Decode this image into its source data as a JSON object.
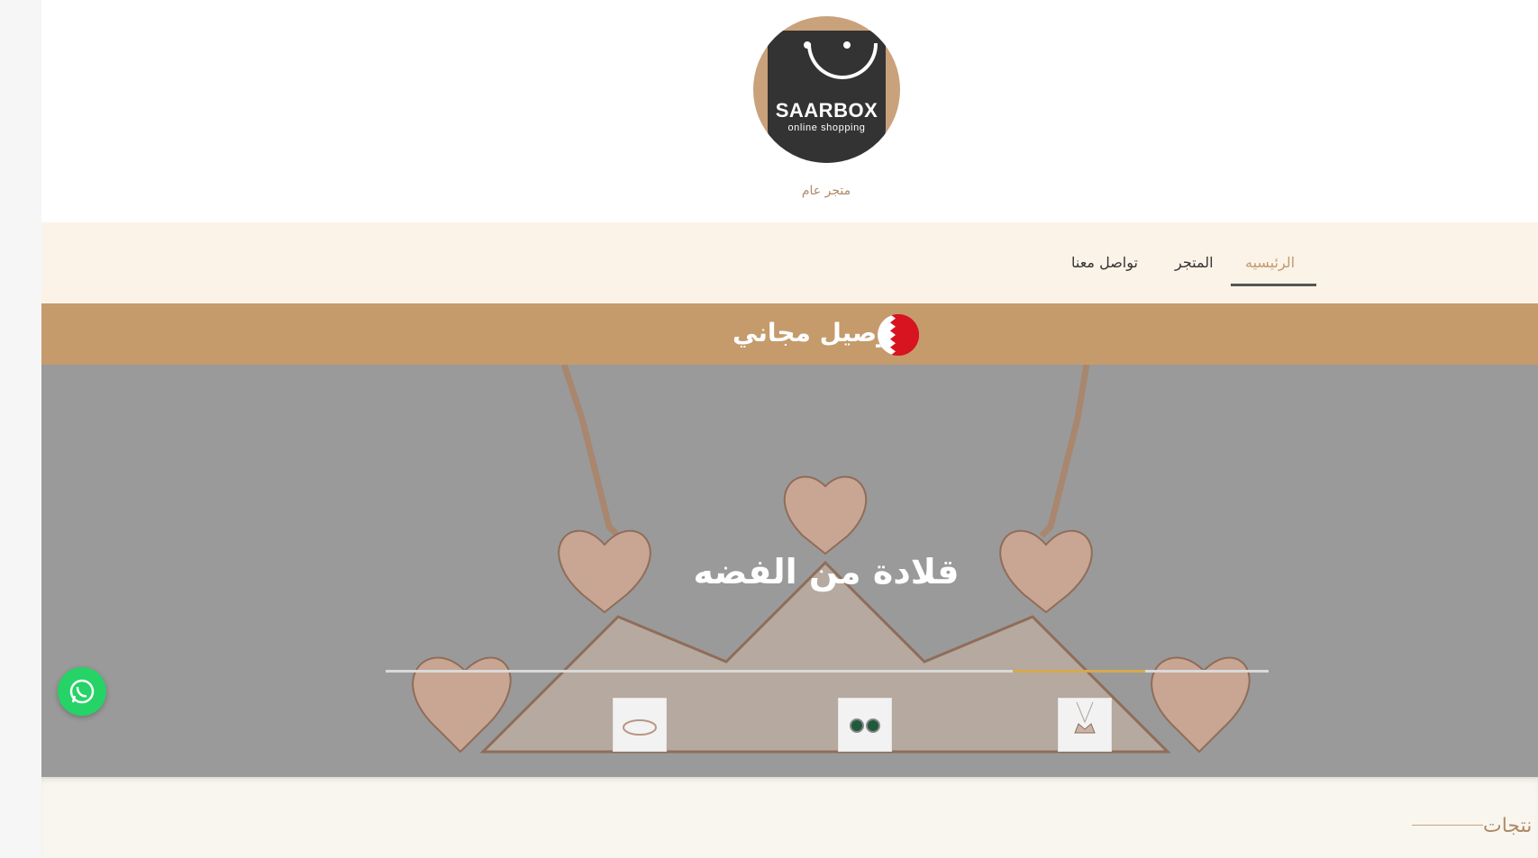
{
  "brand": {
    "logo_title": "SAARBOX",
    "logo_subtitle": "online shopping",
    "tagline": "متجر عام"
  },
  "nav": {
    "items": [
      {
        "label": "الرئيسيه",
        "active": true
      },
      {
        "label": "المتجر",
        "active": false
      },
      {
        "label": "تواصل معنا",
        "active": false
      }
    ]
  },
  "promo": {
    "text": "توصيل مجاني",
    "flag_icon": "bahrain-flag-icon"
  },
  "hero": {
    "title": "قلادة من الفضه",
    "slider_progress_percent": 15,
    "thumbnails": [
      {
        "name": "ring-thumbnail"
      },
      {
        "name": "earrings-thumbnail"
      },
      {
        "name": "crown-necklace-thumbnail",
        "active": true
      }
    ]
  },
  "section": {
    "title": "نتجات"
  },
  "colors": {
    "accent": "#c59b6c",
    "nav_bg": "#fcf3e8",
    "active_nav": "#c19a70",
    "whatsapp": "#25d366"
  },
  "icons": {
    "whatsapp": "whatsapp-icon"
  }
}
